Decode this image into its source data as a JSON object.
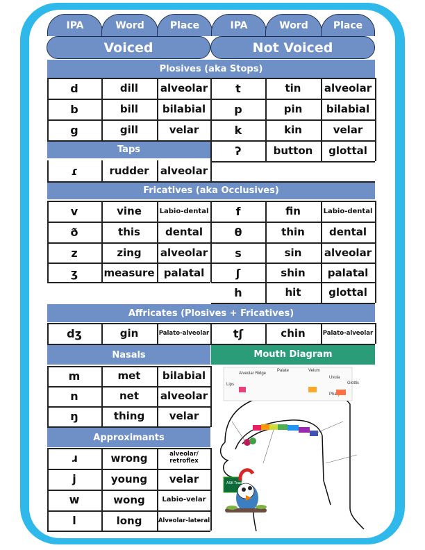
{
  "header": {
    "tabs": [
      "IPA",
      "Word",
      "Place",
      "IPA",
      "Word",
      "Place"
    ],
    "voiced_label": "Voiced",
    "not_voiced_label": "Not Voiced"
  },
  "plosives": {
    "title": "Plosives (aka Stops)",
    "voiced": [
      [
        "d",
        "dill",
        "alveolar"
      ],
      [
        "b",
        "bill",
        "bilabial"
      ],
      [
        "g",
        "gill",
        "velar"
      ]
    ],
    "not_voiced": [
      [
        "t",
        "tin",
        "alveolar"
      ],
      [
        "p",
        "pin",
        "bilabial"
      ],
      [
        "k",
        "kin",
        "velar"
      ],
      [
        "ʔ",
        "button",
        "glottal"
      ]
    ]
  },
  "taps": {
    "title": "Taps",
    "voiced": [
      [
        "ɾ",
        "rudder",
        "alveolar"
      ]
    ]
  },
  "fricatives": {
    "title": "Fricatives (aka Occlusives)",
    "voiced": [
      [
        "v",
        "vine",
        "Labio-dental"
      ],
      [
        "ð",
        "this",
        "dental"
      ],
      [
        "z",
        "zing",
        "alveolar"
      ],
      [
        "ʒ",
        "measure",
        "palatal"
      ]
    ],
    "not_voiced": [
      [
        "f",
        "fin",
        "Labio-dental"
      ],
      [
        "θ",
        "thin",
        "dental"
      ],
      [
        "s",
        "sin",
        "alveolar"
      ],
      [
        "ʃ",
        "shin",
        "palatal"
      ],
      [
        "h",
        "hit",
        "glottal"
      ]
    ]
  },
  "affricates": {
    "title": "Affricates (Plosives + Fricatives)",
    "voiced": [
      [
        "dʒ",
        "gin",
        "Palato-alveolar"
      ]
    ],
    "not_voiced": [
      [
        "tʃ",
        "chin",
        "Palato-alveolar"
      ]
    ]
  },
  "nasals": {
    "title": "Nasals",
    "voiced": [
      [
        "m",
        "met",
        "bilabial"
      ],
      [
        "n",
        "net",
        "alveolar"
      ],
      [
        "ŋ",
        "thing",
        "velar"
      ]
    ]
  },
  "approximants": {
    "title": "Approximants",
    "voiced": [
      [
        "ɹ",
        "wrong",
        "alveolar/\nretroflex"
      ],
      [
        "j",
        "young",
        "velar"
      ],
      [
        "w",
        "wong",
        "Labio-velar"
      ],
      [
        "l",
        "long",
        "Alveolar-lateral"
      ]
    ]
  },
  "mouth_diagram": {
    "title": "Mouth Diagram",
    "labels": [
      "Palate",
      "Velum",
      "Alveolar Ridge",
      "Uvula",
      "Glottis",
      "Lips",
      "Pharynx"
    ]
  },
  "mascot": {
    "sign_text": "ASK Teacher"
  },
  "colors": {
    "frame": "#2fb9ea",
    "header_blue": "#6e90c7",
    "diagram_green": "#2a9d78"
  }
}
